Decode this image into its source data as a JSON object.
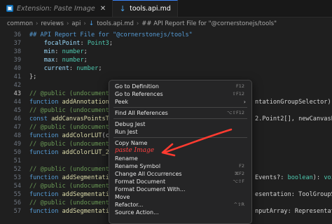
{
  "tabs": [
    {
      "label": "Extension: Paste Image",
      "icon": "extension-icon",
      "active": false
    },
    {
      "label": "tools.api.md",
      "icon": "markdown-icon",
      "active": true
    }
  ],
  "breadcrumb": {
    "segments": [
      "common",
      "reviews",
      "api"
    ],
    "file": "tools.api.md",
    "heading": "## API Report File for \"@cornerstonejs/tools\""
  },
  "editor": {
    "lines": [
      {
        "num": "36",
        "code": "## API Report File for \"@cornerstonejs/tools\""
      },
      {
        "num": "37",
        "code": "    focalPoint: Point3;"
      },
      {
        "num": "38",
        "code": "    min: number;"
      },
      {
        "num": "39",
        "code": "    max: number;"
      },
      {
        "num": "40",
        "code": "    current: number;"
      },
      {
        "num": "41",
        "code": "};"
      },
      {
        "num": "42",
        "code": ""
      },
      {
        "num": "43",
        "code": "// @public (undocumented)"
      },
      {
        "num": "44",
        "code": "function addAnnotation(anno"
      },
      {
        "num": "45",
        "code": "// @public (undocumented)"
      },
      {
        "num": "46",
        "code": "const addCanvasPointsToArra"
      },
      {
        "num": "47",
        "code": "// @public (undocumented)"
      },
      {
        "num": "48",
        "code": "function addColorLUT(colorL"
      },
      {
        "num": "49",
        "code": "// @public (undocumented)"
      },
      {
        "num": "50",
        "code": "function addColorLUT_2(colo"
      },
      {
        "num": "51",
        "code": ""
      },
      {
        "num": "52",
        "code": "// @public (undocumented)"
      },
      {
        "num": "53",
        "code": "function addSegmentation(se"
      },
      {
        "num": "54",
        "code": "// @public (undocumented)"
      },
      {
        "num": "55",
        "code": "function addSegmentationRep"
      },
      {
        "num": "56",
        "code": "// @public (undocumented)"
      },
      {
        "num": "57",
        "code": "function addSegmentationRep"
      }
    ],
    "right_fragments": [
      {
        "line": "44",
        "text": "ntationGroupSelector): str"
      },
      {
        "line": "46",
        "text": "2.Point2[], newCanvasPoint"
      },
      {
        "line": "53",
        "text": "Events?: boolean): void;"
      },
      {
        "line": "55",
        "text": "esentation: ToolGroupSpeci"
      },
      {
        "line": "57",
        "text": "nputArray: RepresentationI"
      }
    ]
  },
  "context_menu": {
    "items": [
      {
        "label": "Go to Definition",
        "shortcut": "F12"
      },
      {
        "label": "Go to References",
        "shortcut": "⇧F12"
      },
      {
        "label": "Peek",
        "submenu": true
      },
      {
        "sep": true
      },
      {
        "label": "Find All References",
        "shortcut": "⌥⇧F12"
      },
      {
        "sep": true
      },
      {
        "label": "Debug Jest"
      },
      {
        "label": "Run Jest"
      },
      {
        "sep": true
      },
      {
        "label": "Copy Name"
      },
      {
        "label": "paste Image",
        "highlight": true
      },
      {
        "label": "Rename"
      },
      {
        "label": "Rename Symbol",
        "shortcut": "F2"
      },
      {
        "label": "Change All Occurrences",
        "shortcut": "⌘F2"
      },
      {
        "label": "Format Document",
        "shortcut": "⌥⇧F"
      },
      {
        "label": "Format Document With..."
      },
      {
        "label": "Move"
      },
      {
        "label": "Refactor...",
        "shortcut": "^⇧R"
      },
      {
        "label": "Source Action..."
      }
    ]
  },
  "colors": {
    "annotation": "#ff3b30",
    "accent": "#3b82f6",
    "comment": "#6a9955",
    "keyword": "#569cd6",
    "function": "#dcdcaa"
  }
}
